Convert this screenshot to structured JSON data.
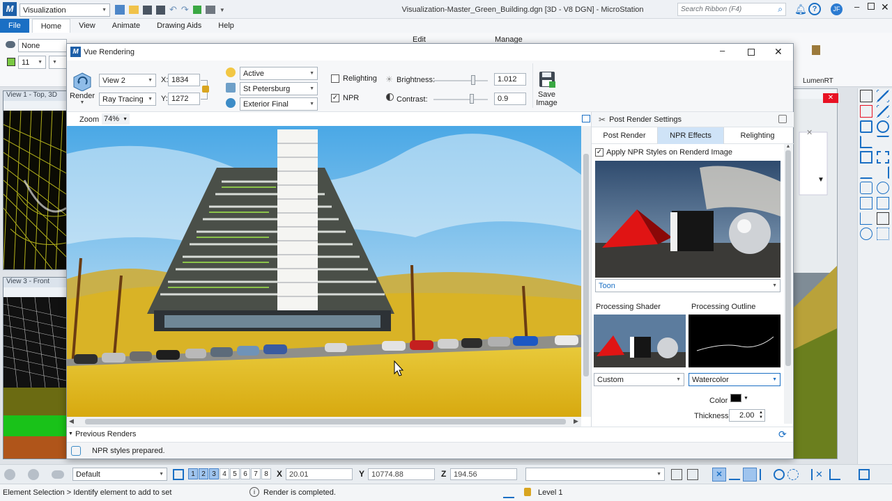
{
  "app": {
    "workflow": "Visualization",
    "window_title": "Visualization-Master_Green_Building.dgn [3D - V8 DGN] - MicroStation",
    "search_placeholder": "Search Ribbon (F4)",
    "user_initials": "JF"
  },
  "ribbon": {
    "tabs": [
      "File",
      "Home",
      "View",
      "Animate",
      "Drawing Aids",
      "Help"
    ],
    "active_tab": "Home",
    "level_value": "None",
    "weight_value": "11",
    "edit_label": "Edit",
    "manage_label": "Manage",
    "lumenrt_label": "LumenRT"
  },
  "viewports": {
    "view1_title": "View 1 - Top, 3D",
    "view3_title": "View 3 - Front"
  },
  "dialog": {
    "title": "Vue Rendering",
    "render_label": "Render",
    "view_select": "View 2",
    "mode_select": "Ray Tracing",
    "x_label": "X:",
    "x_value": "1834",
    "y_label": "Y:",
    "y_value": "1272",
    "active_select": "Active",
    "location_select": "St Petersburg",
    "preset_select": "Exterior Final",
    "relighting_label": "Relighting",
    "relighting_checked": false,
    "npr_label": "NPR",
    "npr_checked": true,
    "brightness_label": "Brightness:",
    "brightness_value": "1.012",
    "contrast_label": "Contrast:",
    "contrast_value": "0.9",
    "save_image_label_1": "Save",
    "save_image_label_2": "Image",
    "zoom_label": "Zoom",
    "zoom_value": "74%",
    "previous_renders_label": "Previous Renders",
    "status_text": "NPR styles prepared."
  },
  "post_render": {
    "title": "Post Render Settings",
    "tabs": [
      "Post Render",
      "NPR Effects",
      "Relighting"
    ],
    "active_tab": "NPR Effects",
    "apply_npr_label": "Apply NPR Styles on Renderd Image",
    "apply_npr_checked": true,
    "style_select": "Toon",
    "processing_shader_label": "Processing Shader",
    "processing_outline_label": "Processing Outline",
    "shader_select": "Custom",
    "outline_select": "Watercolor",
    "color_label": "Color",
    "thickness_label": "Thickness",
    "thickness_value": "2.00"
  },
  "bottom_toolbar": {
    "model_select": "Default",
    "view_numbers": [
      "1",
      "2",
      "3",
      "4",
      "5",
      "6",
      "7",
      "8"
    ],
    "active_views": [
      "1",
      "2",
      "3"
    ],
    "x_label": "X",
    "x_value": "20.01",
    "y_label": "Y",
    "y_value": "10774.88",
    "z_label": "Z",
    "z_value": "194.56"
  },
  "statusbar": {
    "prompt": "Element Selection > Identify element to add to set",
    "message": "Render is completed.",
    "level": "Level 1"
  },
  "colors": {
    "accent_blue": "#1a6fc4",
    "selected_tab": "#cfe3f7",
    "close_red": "#e81123"
  }
}
